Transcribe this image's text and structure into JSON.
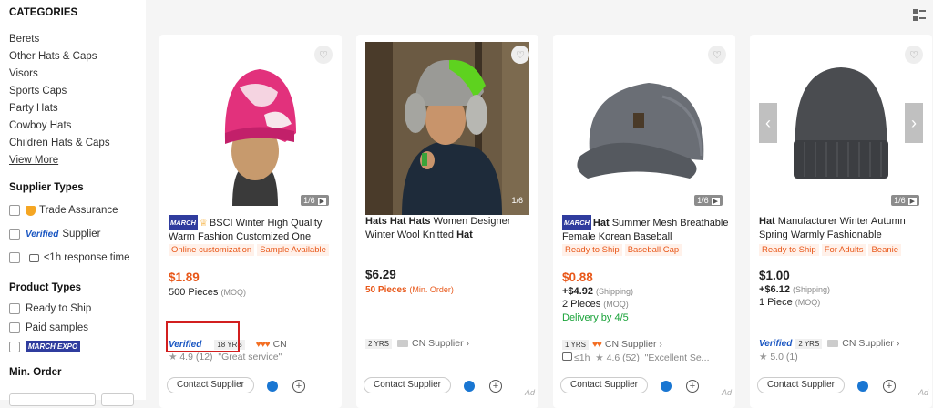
{
  "sidebar": {
    "categories_title": "CATEGORIES",
    "categories": [
      "Berets",
      "Other Hats & Caps",
      "Visors",
      "Sports Caps",
      "Party Hats",
      "Cowboy Hats",
      "Children Hats & Caps"
    ],
    "view_more": "View More",
    "supplier_types_title": "Supplier Types",
    "trade_assurance": "Trade Assurance",
    "verified_logo": "Verified",
    "verified_supplier": "Supplier",
    "response_time": "≤1h response time",
    "product_types_title": "Product Types",
    "ready_to_ship": "Ready to Ship",
    "paid_samples": "Paid samples",
    "march_expo": "MARCH EXPO",
    "min_order_title": "Min. Order"
  },
  "cards": [
    {
      "badge": "MARCH",
      "title_bold": "",
      "title_rest": "BSCI Winter High Quality Warm Fashion Customized One",
      "tags": [
        "Online customization",
        "Sample Available"
      ],
      "price": "$1.89",
      "moq_value": "500 Pieces",
      "moq_label": "(MOQ)",
      "verified": "Verified",
      "years": "18 YRS",
      "country": "CN",
      "rating": "4.9 (12)",
      "review": "\"Great service\"",
      "counter": "1/6",
      "contact": "Contact Supplier"
    },
    {
      "title_bold": "Hats Hat Hats",
      "title_rest": " Women Designer Winter Wool Knitted ",
      "title_bold2": "Hat",
      "price": "$6.29",
      "moq_value": "50 Pieces",
      "moq_label": "(Min. Order)",
      "years": "2 YRS",
      "country": "CN",
      "supplier": "Supplier ›",
      "counter": "1/6",
      "contact": "Contact Supplier",
      "ad": "Ad"
    },
    {
      "badge": "MARCH",
      "title_bold": "Hat",
      "title_rest": " Summer Mesh Breathable Female Korean Baseball",
      "tags": [
        "Ready to Ship",
        "Baseball Cap"
      ],
      "price": "$0.88",
      "shipping_value": "+$4.92",
      "shipping_label": "(Shipping)",
      "moq_value": "2 Pieces",
      "moq_label": "(MOQ)",
      "delivery": "Delivery by 4/5",
      "years": "1 YRS",
      "country": "CN",
      "supplier": "Supplier ›",
      "response": "≤1h",
      "rating": "4.6 (52)",
      "review": "\"Excellent Se...",
      "counter": "1/6",
      "contact": "Contact Supplier",
      "ad": "Ad"
    },
    {
      "title_bold": "Hat",
      "title_rest": " Manufacturer Winter Autumn Spring Warmly Fashionable",
      "tags": [
        "Ready to Ship",
        "For Adults",
        "Beanie"
      ],
      "price": "$1.00",
      "shipping_value": "+$6.12",
      "shipping_label": "(Shipping)",
      "moq_value": "1 Piece",
      "moq_label": "(MOQ)",
      "verified": "Verified",
      "years": "2 YRS",
      "country": "CN",
      "supplier": "Supplier ›",
      "rating": "5.0 (1)",
      "counter": "1/6",
      "contact": "Contact Supplier",
      "ad": "Ad"
    }
  ]
}
